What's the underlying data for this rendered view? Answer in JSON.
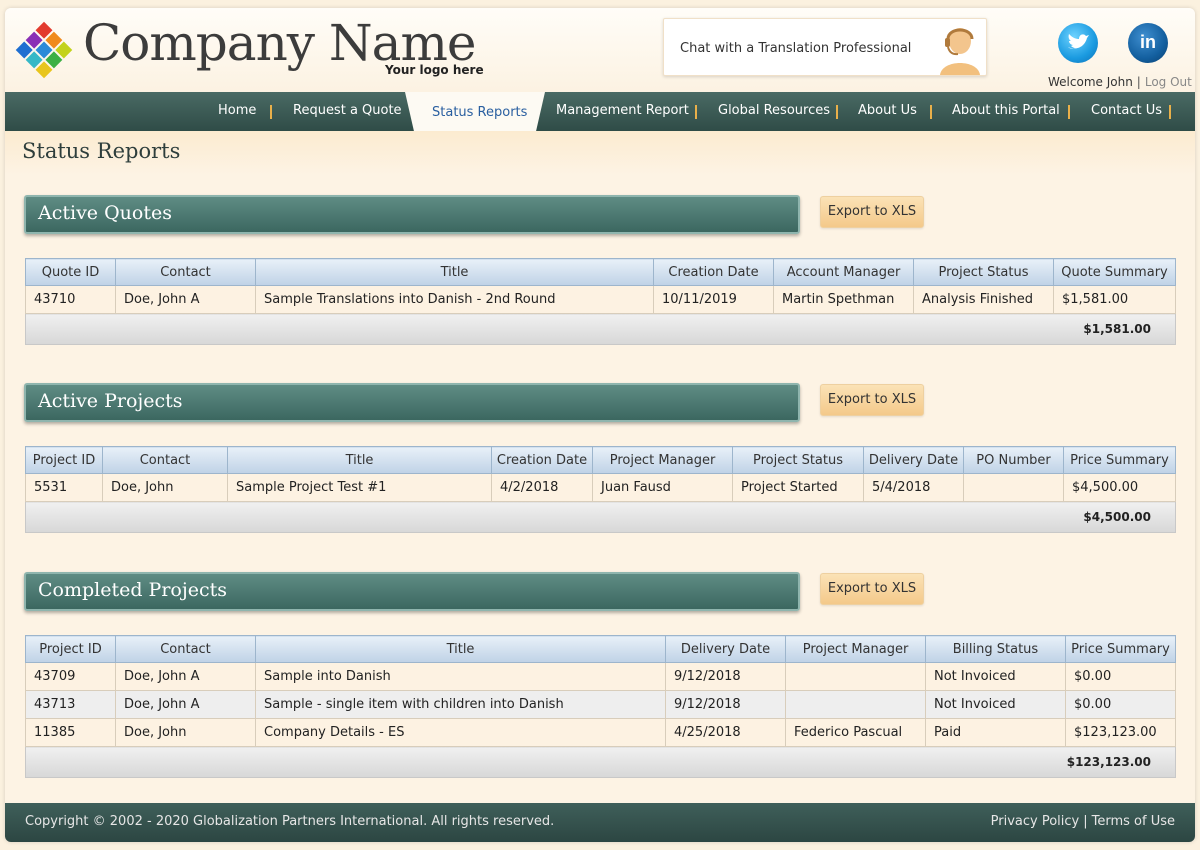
{
  "brand": {
    "company_name": "Company Name",
    "tagline": "Your logo here"
  },
  "chat": {
    "label": "Chat with a Translation Professional"
  },
  "social": {
    "linkedin_text": "in"
  },
  "user": {
    "welcome": "Welcome John",
    "sep": "|",
    "logout": "Log Out"
  },
  "nav": {
    "items": [
      "Home",
      "Request a Quote",
      "Status Reports",
      "Management Report",
      "Global Resources",
      "About Us",
      "About this Portal",
      "Contact Us"
    ],
    "active": "Status Reports"
  },
  "page_title": "Status Reports",
  "export_label": "Export to XLS",
  "active_quotes": {
    "title": "Active Quotes",
    "columns": [
      "Quote ID",
      "Contact",
      "Title",
      "Creation Date",
      "Account Manager",
      "Project Status",
      "Quote Summary"
    ],
    "rows": [
      [
        "43710",
        "Doe, John A",
        "Sample Translations into Danish - 2nd Round",
        "10/11/2019",
        "Martin Spethman",
        "Analysis Finished",
        "$1,581.00"
      ]
    ],
    "total": "$1,581.00"
  },
  "active_projects": {
    "title": "Active Projects",
    "columns": [
      "Project ID",
      "Contact",
      "Title",
      "Creation Date",
      "Project Manager",
      "Project Status",
      "Delivery Date",
      "PO Number",
      "Price Summary"
    ],
    "rows": [
      [
        "5531",
        "Doe, John",
        "Sample Project Test #1",
        "4/2/2018",
        "Juan Fausd",
        "Project Started",
        "5/4/2018",
        "",
        "$4,500.00"
      ]
    ],
    "total": "$4,500.00"
  },
  "completed_projects": {
    "title": "Completed Projects",
    "columns": [
      "Project ID",
      "Contact",
      "Title",
      "Delivery Date",
      "Project Manager",
      "Billing Status",
      "Price Summary"
    ],
    "rows": [
      [
        "43709",
        "Doe, John A",
        "Sample into Danish",
        "9/12/2018",
        "",
        "Not Invoiced",
        "$0.00"
      ],
      [
        "43713",
        "Doe, John A",
        "Sample - single item with children into Danish",
        "9/12/2018",
        "",
        "Not Invoiced",
        "$0.00"
      ],
      [
        "11385",
        "Doe, John",
        "Company Details - ES",
        "4/25/2018",
        "Federico Pascual",
        "Paid",
        "$123,123.00"
      ]
    ],
    "total": "$123,123.00"
  },
  "footer": {
    "copyright": "Copyright © 2002 - 2020 Globalization Partners International. All rights reserved.",
    "privacy": "Privacy Policy",
    "sep": "|",
    "terms": "Terms of Use"
  },
  "colors": {
    "nav_bg": "#3c5a55",
    "section_header": "#4d7a72",
    "export_button": "#f6d29c",
    "table_header": "#cddcec",
    "page_bg": "#fdf3e4",
    "active_tab_text": "#2a5fa0"
  },
  "icons": [
    "logo-diamonds-icon",
    "agent-headset-icon",
    "twitter-icon",
    "linkedin-icon"
  ]
}
